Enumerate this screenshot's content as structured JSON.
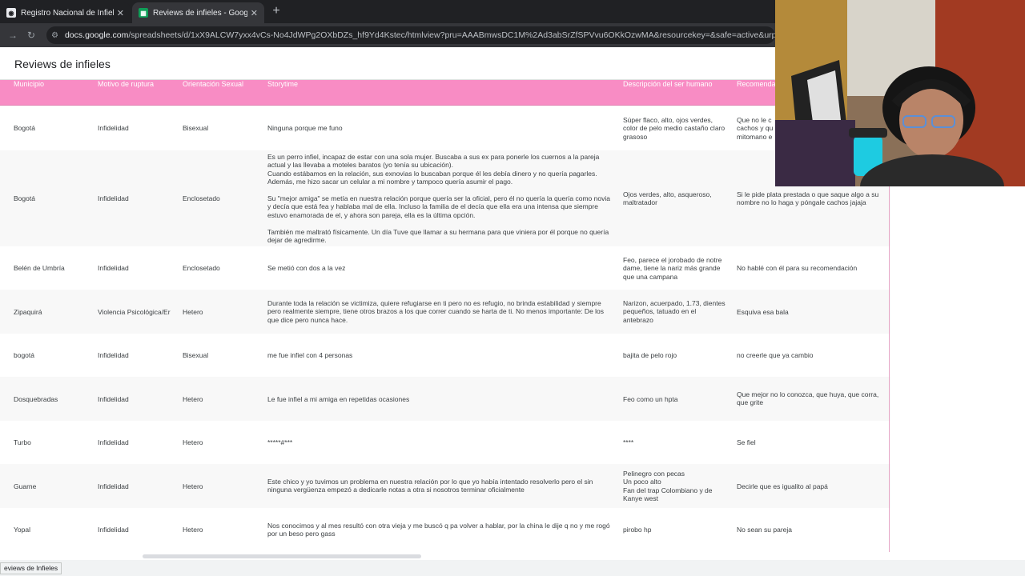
{
  "browser": {
    "tabs": [
      {
        "title": "Registro Nacional de Infieles |",
        "favicon": "app-icon"
      },
      {
        "title": "Reviews de infieles - Google Do",
        "favicon": "sheets-icon"
      }
    ],
    "url_host": "docs.google.com",
    "url_path": "/spreadsheets/d/1xX9ALCW7yxx4vCs-No4JdWPg2OXbDZs_hf9Yd4Kstec/htmlview?pru=AAABmwsDC1M%2Ad3abSrZfSPVvu6OKkOzwMA&resourcekey=&safe=active&urp=linked&usp=fo"
  },
  "sheet": {
    "title": "Reviews de infieles",
    "columns": [
      "Municipio",
      "Motivo de ruptura",
      "Orientación Sexual",
      "Storytime",
      "Descripción del ser humano",
      "Recomendación"
    ],
    "rows": [
      {
        "municipio": "Bogotá",
        "motivo": "Infidelidad",
        "orientacion": "Bisexual",
        "storytime": "Ninguna porque me funo",
        "descripcion": "Súper flaco, alto, ojos verdes, color de pelo medio castaño claro grasoso",
        "recomendacion": "Que no le c\ncachos y qu\nmitomano e"
      },
      {
        "municipio": "Bogotá",
        "motivo": "Infidelidad",
        "orientacion": "Enclosetado",
        "storytime": "Es un perro infiel, incapaz de estar con una sola mujer. Buscaba a sus ex para ponerle los cuernos a la pareja actual y las llevaba a moteles baratos (yo tenía su ubicación).\nCuando estábamos en la relación, sus exnovias lo buscaban porque él les debía dinero y no quería pagarles. Además, me hizo sacar un celular a mi nombre y tampoco quería asumir el pago.\n\nSu \"mejor amiga\" se metía en nuestra relación porque quería ser la oficial, pero él no quería la quería como novia y decía que está fea y hablaba mal de ella. Incluso la familia de el decía que ella era una intensa que siempre estuvo enamorada de el, y ahora son pareja, ella es la última opción.\n\nTambién me maltrató físicamente. Un día Tuve que llamar a su hermana para que viniera por él porque no quería dejar de agredirme.",
        "descripcion": "Ojos verdes, alto, asqueroso, maltratador",
        "recomendacion": "Si le pide plata prestada o que saque algo a su nombre no lo haga y póngale cachos jajaja"
      },
      {
        "municipio": "Belén de Umbría",
        "motivo": "Infidelidad",
        "orientacion": "Enclosetado",
        "storytime": "Se metió con dos a la vez",
        "descripcion": "Feo, parece el jorobado de notre dame, tiene la nariz más grande que una campana",
        "recomendacion": "No hablé con él para su recomendación"
      },
      {
        "municipio": "Zipaquirá",
        "motivo": "Violencia Psicológica/Er",
        "orientacion": "Hetero",
        "storytime": "Durante toda la relación se victimiza, quiere refugiarse en ti pero no es refugio, no brinda estabilidad y siempre pero realmente siempre, tiene otros brazos a los que correr cuando se harta de ti. No menos importante: De los que dice pero nunca hace.",
        "descripcion": "Narizon, acuerpado, 1.73, dientes pequeños, tatuado en el antebrazo",
        "recomendacion": "Esquiva esa bala"
      },
      {
        "municipio": "bogotá",
        "motivo": "Infidelidad",
        "orientacion": "Bisexual",
        "storytime": "me fue infiel con 4 personas",
        "descripcion": "bajita de pelo rojo",
        "recomendacion": "no creerle que ya cambio"
      },
      {
        "municipio": "Dosquebradas",
        "motivo": "Infidelidad",
        "orientacion": "Hetero",
        "storytime": "Le fue infiel a mi amiga en repetidas ocasiones",
        "descripcion": "Feo como un hpta",
        "recomendacion": "Que mejor no lo conozca, que huya, que corra, que grite"
      },
      {
        "municipio": "Turbo",
        "motivo": "Infidelidad",
        "orientacion": "Hetero",
        "storytime": "*****#***",
        "descripcion": "****",
        "recomendacion": "Se fiel"
      },
      {
        "municipio": "Guarne",
        "motivo": "Infidelidad",
        "orientacion": "Hetero",
        "storytime": "Este chico y yo tuvimos un problema en nuestra relación por lo que yo había intentado resolverlo pero el sin ninguna vergüenza empezó a dedicarle notas a otra si nosotros terminar oficialmente",
        "descripcion": "Pelinegro con pecas\nUn poco alto\nFan del trap Colombiano y de Kanye west",
        "recomendacion": "Decirle que es igualito al papá"
      },
      {
        "municipio": "Yopal",
        "motivo": "Infidelidad",
        "orientacion": "Hetero",
        "storytime": "Nos conocimos y al mes resultó con otra vieja y me buscó q pa volver a hablar, por la china le dije q no y me rogó por un beso pero gass",
        "descripcion": "pirobo hp",
        "recomendacion": "No sean su pareja"
      }
    ]
  },
  "status": {
    "tooltip": "eviews de Infieles"
  },
  "colors": {
    "header_pink": "#f88cc4",
    "browser_dark": "#202124",
    "browser_toolbar": "#35363a"
  }
}
